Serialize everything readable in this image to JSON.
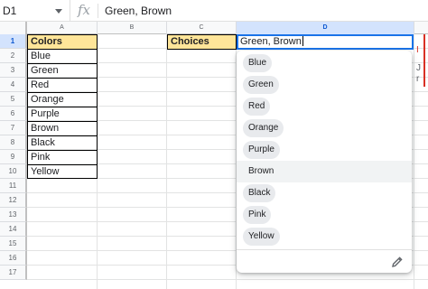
{
  "formula_bar": {
    "cell_ref": "D1",
    "fx_label": "fx",
    "value": "Green, Brown"
  },
  "columns": [
    "A",
    "B",
    "C",
    "D"
  ],
  "rows": [
    "1",
    "2",
    "3",
    "4",
    "5",
    "6",
    "7",
    "8",
    "9",
    "10",
    "11",
    "12",
    "13",
    "14",
    "15",
    "16",
    "17"
  ],
  "sheet": {
    "colors_header": "Colors",
    "colors": [
      "Blue",
      "Green",
      "Red",
      "Orange",
      "Purple",
      "Brown",
      "Black",
      "Pink",
      "Yellow"
    ],
    "choices_label": "Choices",
    "choices_value": "Green, Brown"
  },
  "dropdown": {
    "options": [
      "Blue",
      "Green",
      "Red",
      "Orange",
      "Purple",
      "Brown",
      "Black",
      "Pink",
      "Yellow"
    ],
    "hovered": "Brown",
    "edit_icon": "pencil-icon"
  },
  "side_tab": {
    "lines": [
      "I",
      "J",
      "r"
    ],
    "accent": "#d93025"
  },
  "colors": {
    "header_fill": "#ffe599",
    "selection_blue": "#1a73e8"
  }
}
